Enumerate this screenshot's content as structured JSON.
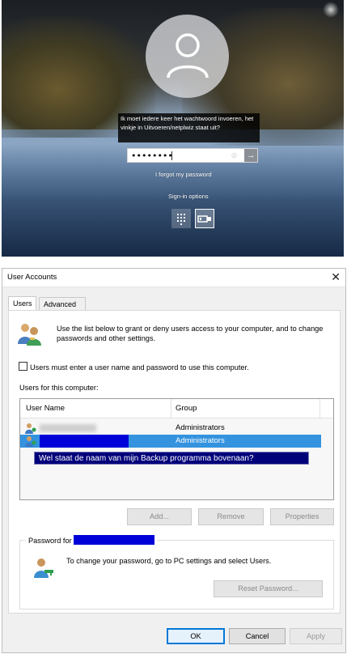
{
  "lock_screen": {
    "question": "Ik moet iedere keer het wachtwoord invoeren, het vinkje in Uitvoeren/netplwiz staat uit?",
    "password_dots": "••••••••",
    "forgot_password": "I forgot my password",
    "sign_in_options": "Sign-in options"
  },
  "dialog": {
    "title": "User Accounts",
    "close_glyph": "✕",
    "tabs": [
      "Users",
      "Advanced"
    ],
    "intro_text": "Use the list below to grant or deny users access to your computer, and to change passwords and other settings.",
    "require_password_label": "Users must enter a user name and password to use this computer.",
    "require_password_checked": false,
    "users_label": "Users for this computer:",
    "columns": [
      "User Name",
      "Group"
    ],
    "users": [
      {
        "group": "Administrators",
        "selected": false
      },
      {
        "group": "Administrators",
        "selected": true
      }
    ],
    "annotation": "Wel staat de naam van mijn Backup programma bovenaan?",
    "buttons": {
      "add": "Add...",
      "remove": "Remove",
      "properties": "Properties"
    },
    "password_group_label": "Password for",
    "password_text": "To change your password, go to PC settings and select Users.",
    "reset_password": "Reset Password...",
    "footer": {
      "ok": "OK",
      "cancel": "Cancel",
      "apply": "Apply"
    }
  },
  "colors": {
    "selection": "#3393df",
    "redaction": "#0000d8",
    "annotation_bg": "#00007a"
  }
}
